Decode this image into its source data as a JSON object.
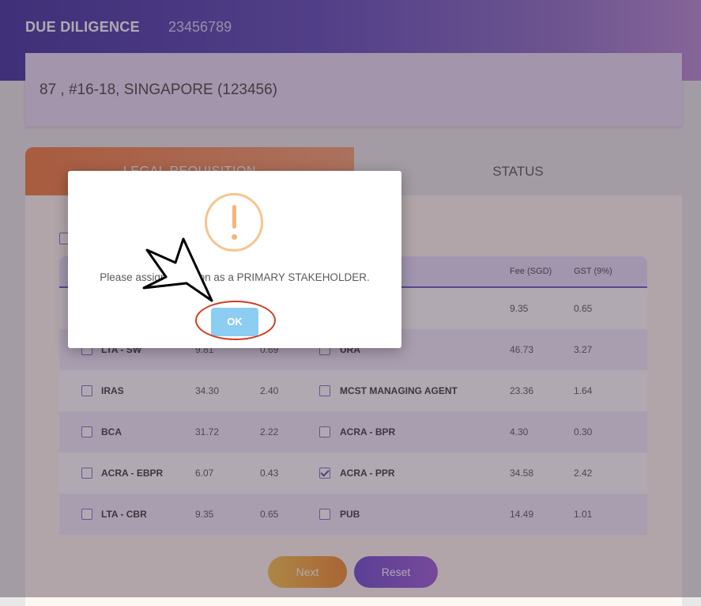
{
  "header": {
    "title": "DUE DILIGENCE",
    "reference": "23456789"
  },
  "address": "87 , #16-18, SINGAPORE (123456)",
  "tabs": {
    "legal": "LEGAL REQUISITION",
    "status": "STATUS"
  },
  "table": {
    "headers": {
      "fee": "Fee (SGD)",
      "gst": "GST (9%)"
    },
    "rows": [
      {
        "left": {
          "name": "",
          "fee": "",
          "gst": ""
        },
        "right": {
          "name": "",
          "fee": "9.35",
          "gst": "0.65",
          "checked": false
        }
      },
      {
        "left": {
          "name": "LTA - SW",
          "fee": "9.81",
          "gst": "0.69"
        },
        "right": {
          "name": "URA",
          "fee": "46.73",
          "gst": "3.27",
          "checked": false
        }
      },
      {
        "left": {
          "name": "IRAS",
          "fee": "34.30",
          "gst": "2.40"
        },
        "right": {
          "name": "MCST MANAGING AGENT",
          "fee": "23.36",
          "gst": "1.64",
          "checked": false
        }
      },
      {
        "left": {
          "name": "BCA",
          "fee": "31.72",
          "gst": "2.22"
        },
        "right": {
          "name": "ACRA - BPR",
          "fee": "4.30",
          "gst": "0.30",
          "checked": false
        }
      },
      {
        "left": {
          "name": "ACRA - EBPR",
          "fee": "6.07",
          "gst": "0.43"
        },
        "right": {
          "name": "ACRA - PPR",
          "fee": "34.58",
          "gst": "2.42",
          "checked": true
        }
      },
      {
        "left": {
          "name": "LTA - CBR",
          "fee": "9.35",
          "gst": "0.65"
        },
        "right": {
          "name": "PUB",
          "fee": "14.49",
          "gst": "1.01",
          "checked": false
        }
      }
    ]
  },
  "buttons": {
    "next": "Next",
    "reset": "Reset"
  },
  "dialog": {
    "icon": "exclamation-icon",
    "message": "Please assign a person as a PRIMARY STAKEHOLDER.",
    "ok": "OK"
  },
  "colors": {
    "accent": "#5a48b8",
    "warning": "#f2b679",
    "ok_button": "#8ccdf1",
    "highlight": "#d23b1e"
  }
}
